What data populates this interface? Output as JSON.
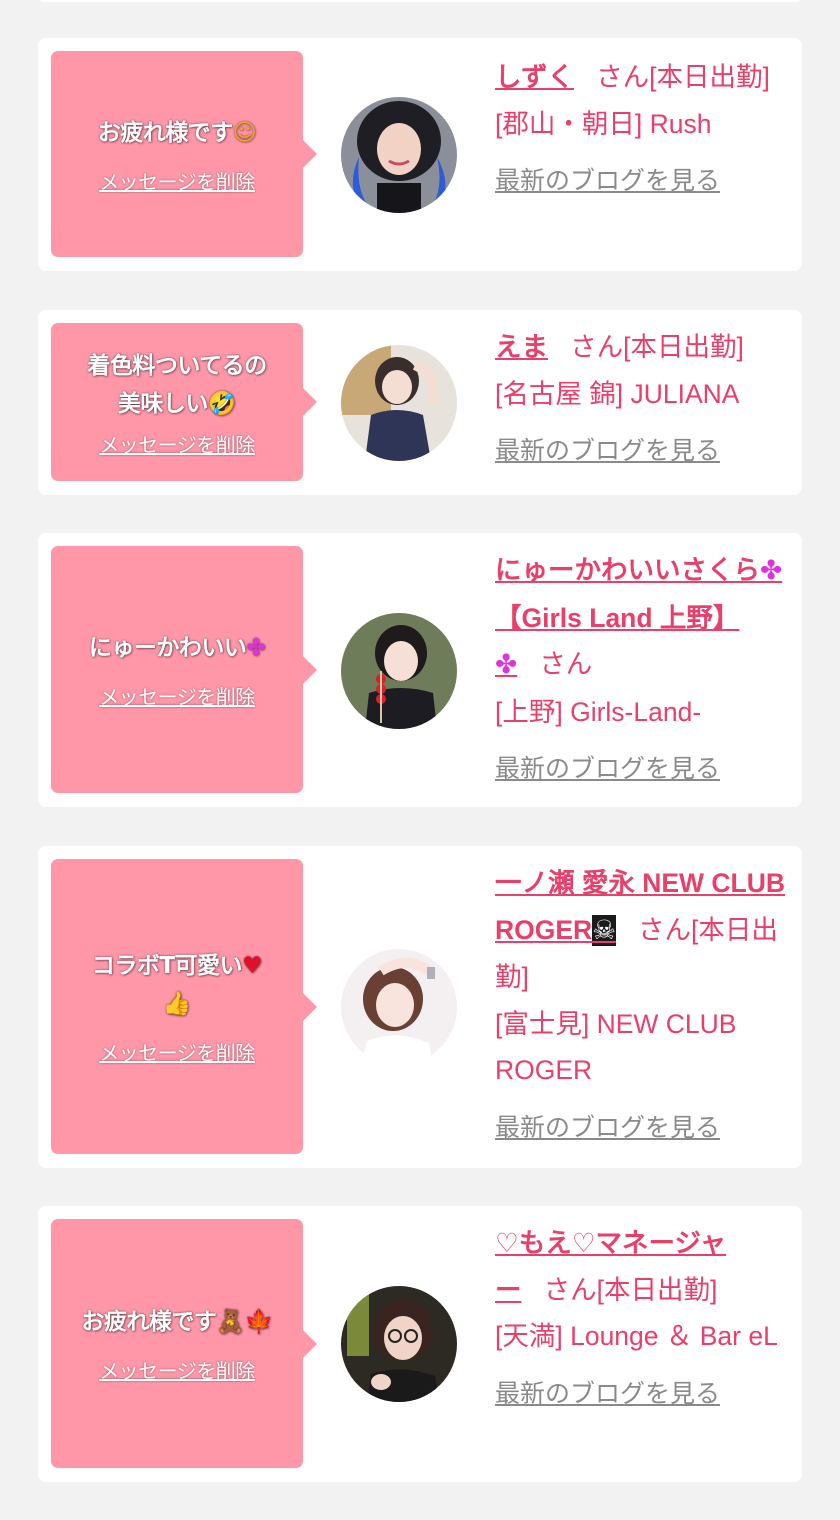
{
  "cards": [
    {
      "message": "お疲れ様です",
      "message_emoji": "☺",
      "delete_label": "メッセージを削除",
      "name": "しずく",
      "san_status": "さん[本日出勤]",
      "shop": "[郡山・朝日] Rush",
      "blog_label": "最新のブログを見る"
    },
    {
      "message_line1": "着色料ついてるの",
      "message_line2": "美味しい",
      "message_emoji": "🤣",
      "delete_label": "メッセージを削除",
      "name": "えま",
      "san_status": "さん[本日出勤]",
      "shop": "[名古屋 錦] JULIANA",
      "blog_label": "最新のブログを見る"
    },
    {
      "message": "にゅーかわいい",
      "message_emoji": "✤",
      "delete_label": "メッセージを削除",
      "name_part1": "にゅーかわいいさくら",
      "name_part2": "【Girls Land 上野】",
      "name_emoji": "✤",
      "san": "さん",
      "shop": "[上野] Girls-Land-",
      "blog_label": "最新のブログを見る"
    },
    {
      "message": "コラボT可愛い",
      "message_emoji": "♥",
      "message_emoji2": "👍",
      "delete_label": "メッセージを削除",
      "name": "一ノ瀬 愛永 NEW CLUB ROGER",
      "name_emoji": "☠",
      "san_status": "さん[本日出勤]",
      "shop": "[富士見] NEW CLUB ROGER",
      "blog_label": "最新のブログを見る"
    },
    {
      "message": "お疲れ様です",
      "message_emoji": "🧸🍁",
      "delete_label": "メッセージを削除",
      "name": "♡もえ♡マネージャー",
      "san_status": "さん[本日出勤]",
      "shop": "[天満] Lounge ＆ Bar eL",
      "blog_label": "最新のブログを見る"
    }
  ],
  "colors": {
    "background": "#f2f2f2",
    "bubble": "#ff97a9",
    "accent": "#e8406a",
    "link_gray": "#8a8a8a"
  }
}
